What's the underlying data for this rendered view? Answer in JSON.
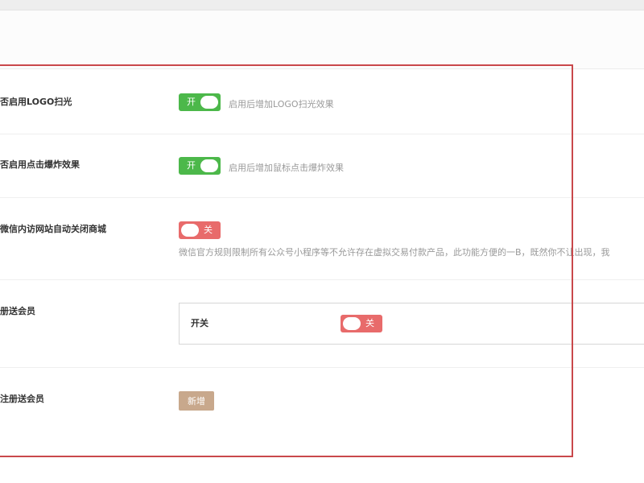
{
  "settings": {
    "logo_shine": {
      "label": "否启用LOGO扫光",
      "toggle_text": "开",
      "hint": "启用后增加LOGO扫光效果"
    },
    "click_burst": {
      "label": "否启用点击爆炸效果",
      "toggle_text": "开",
      "hint": "启用后增加鼠标点击爆炸效果"
    },
    "wechat_close": {
      "label": "微信内访网站自动关闭商城",
      "toggle_text": "关",
      "hint": "微信官方规则限制所有公众号小程序等不允许存在虚拟交易付款产品，此功能方便的一B，既然你不让出现，我"
    },
    "register_gift": {
      "label": "册送会员",
      "sub_label": "开关",
      "toggle_text": "关"
    },
    "follow_gift": {
      "label": "注册送会员",
      "button_label": "新增"
    }
  },
  "colors": {
    "toggle_on": "#4cb84a",
    "toggle_off": "#e86b6b",
    "add_button": "#c8a88c",
    "highlight_border": "#c9484b"
  }
}
